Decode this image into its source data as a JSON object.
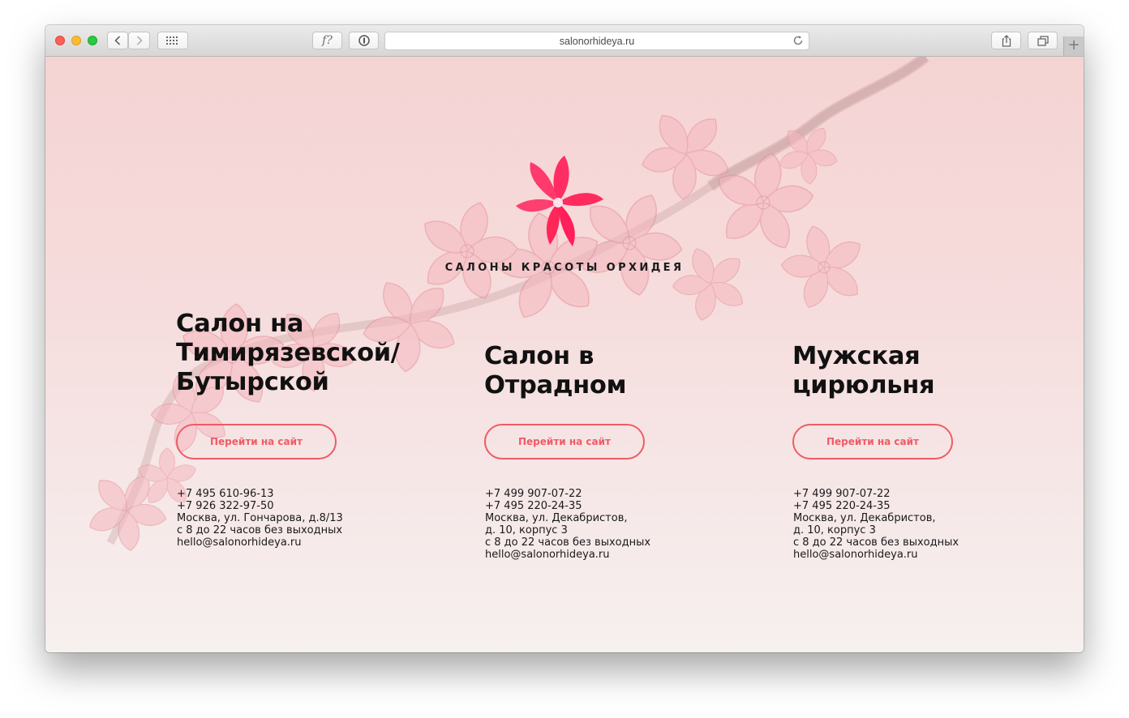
{
  "browser": {
    "url": "salonorhideya.ru",
    "reader_label": "f?",
    "new_tab_label": "+"
  },
  "page": {
    "brand": "САЛОНЫ КРАСОТЫ ОРХИДЕЯ",
    "salons": [
      {
        "title_lines": [
          "Салон на",
          "Тимирязевской/",
          "Бутырской"
        ],
        "button_label": "Перейти на сайт",
        "contacts": [
          "+7 495 610-96-13",
          "+7 926 322-97-50",
          "Москва, ул. Гончарова, д.8/13",
          "с 8 до 22 часов без выходных",
          "hello@salonorhideya.ru"
        ]
      },
      {
        "title_lines": [
          "Салон в",
          "Отрадном"
        ],
        "button_label": "Перейти на сайт",
        "contacts": [
          "+7 499 907-07-22",
          "+7 495 220-24-35",
          "Москва, ул. Декабристов,",
          "д. 10, корпус 3",
          "с 8 до 22 часов без выходных",
          "hello@salonorhideya.ru"
        ]
      },
      {
        "title_lines": [
          "Мужская",
          "цирюльня"
        ],
        "button_label": "Перейти на сайт",
        "contacts": [
          "+7 499 907-07-22",
          "+7 495 220-24-35",
          "Москва, ул. Декабристов,",
          "д. 10, корпус 3",
          "с 8 до 22 часов без выходных",
          "hello@salonorhideya.ru"
        ]
      }
    ]
  },
  "colors": {
    "accent": "#ef5b65",
    "orchid": "#ff1f5a",
    "text": "#111111"
  },
  "icons": [
    "close-window-icon",
    "minimize-window-icon",
    "zoom-window-icon",
    "chevron-left-icon",
    "chevron-right-icon",
    "grid-icon",
    "info-icon",
    "reload-icon",
    "share-icon",
    "tabs-icon",
    "orchid-logo-icon"
  ]
}
